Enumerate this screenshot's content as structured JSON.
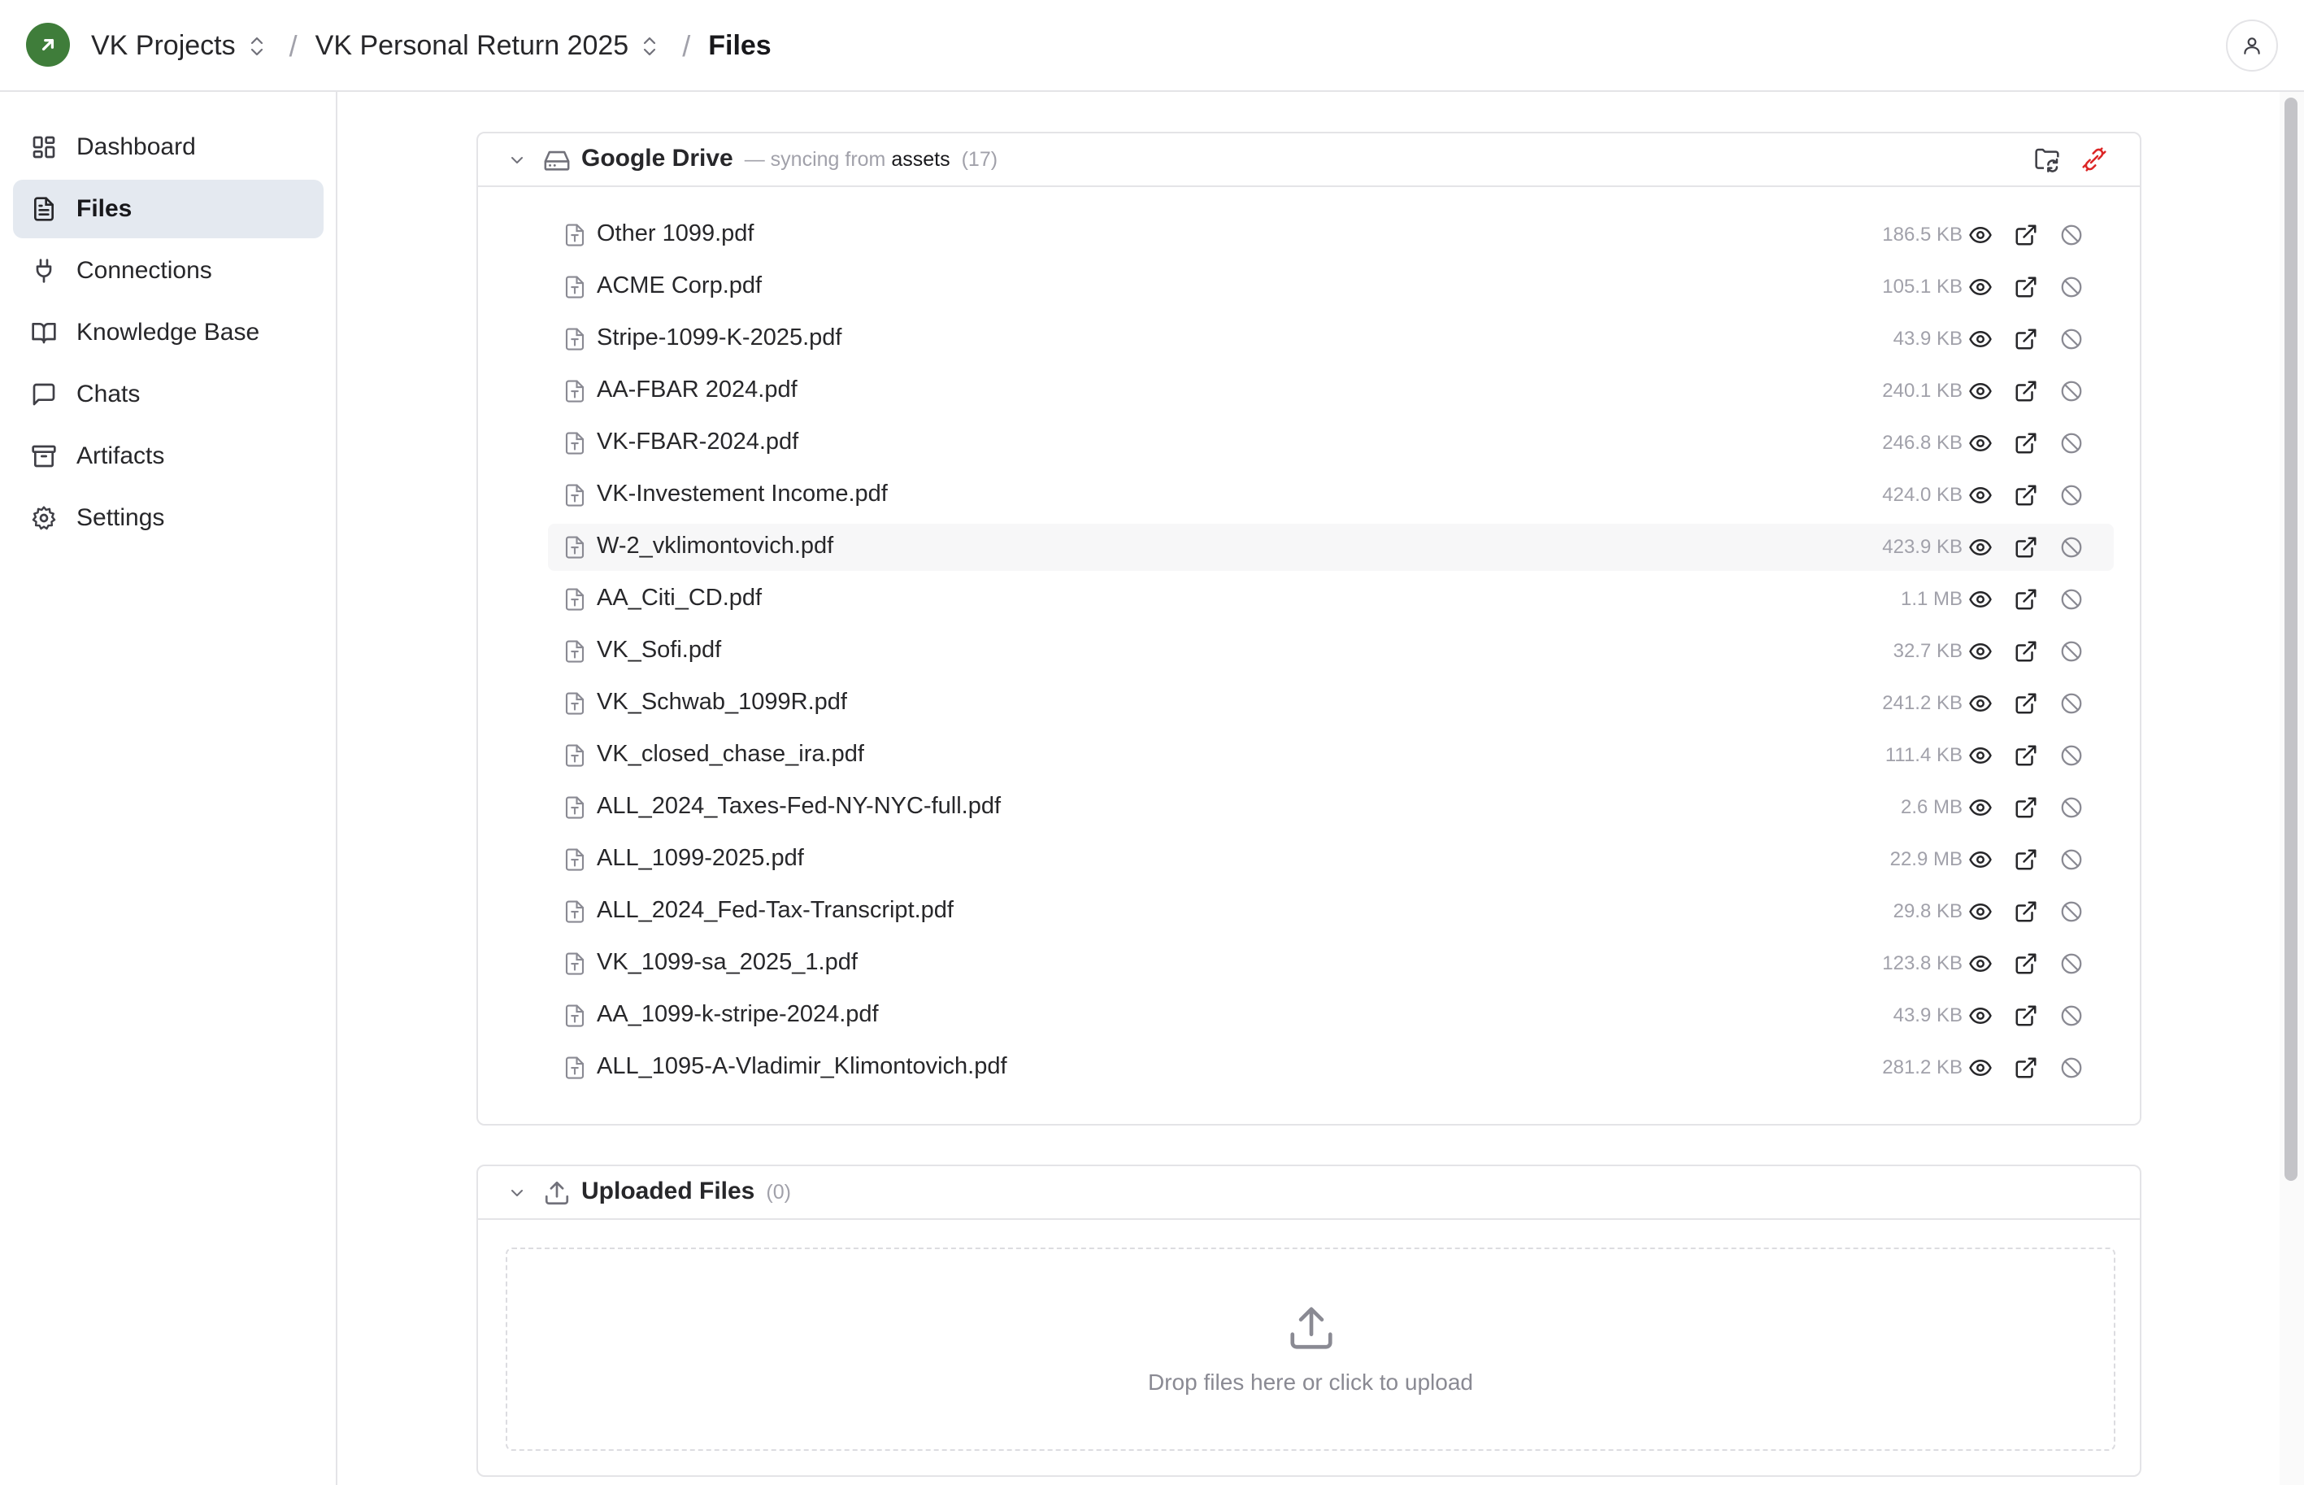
{
  "topbar": {
    "breadcrumbs": [
      {
        "label": "VK Projects"
      },
      {
        "label": "VK Personal Return 2025"
      },
      {
        "label": "Files"
      }
    ],
    "separator": "/",
    "brand_color": "#3f7d3a"
  },
  "sidebar": {
    "items": [
      {
        "label": "Dashboard",
        "icon": "dashboard-icon",
        "active": false
      },
      {
        "label": "Files",
        "icon": "file-text-icon",
        "active": true
      },
      {
        "label": "Connections",
        "icon": "plug-icon",
        "active": false
      },
      {
        "label": "Knowledge Base",
        "icon": "book-icon",
        "active": false
      },
      {
        "label": "Chats",
        "icon": "chat-icon",
        "active": false
      },
      {
        "label": "Artifacts",
        "icon": "archive-icon",
        "active": false
      },
      {
        "label": "Settings",
        "icon": "gear-icon",
        "active": false
      }
    ]
  },
  "drive_panel": {
    "title": "Google Drive",
    "sync_prefix": "— syncing from",
    "sync_folder": "assets",
    "count": "(17)",
    "files": [
      {
        "name": "Other 1099.pdf",
        "size": "186.5 KB"
      },
      {
        "name": "ACME Corp.pdf",
        "size": "105.1 KB"
      },
      {
        "name": "Stripe-1099-K-2025.pdf",
        "size": "43.9 KB"
      },
      {
        "name": "AA-FBAR 2024.pdf",
        "size": "240.1 KB"
      },
      {
        "name": "VK-FBAR-2024.pdf",
        "size": "246.8 KB"
      },
      {
        "name": "VK-Investement Income.pdf",
        "size": "424.0 KB"
      },
      {
        "name": "W-2_vklimontovich.pdf",
        "size": "423.9 KB"
      },
      {
        "name": "AA_Citi_CD.pdf",
        "size": "1.1 MB"
      },
      {
        "name": "VK_Sofi.pdf",
        "size": "32.7 KB"
      },
      {
        "name": "VK_Schwab_1099R.pdf",
        "size": "241.2 KB"
      },
      {
        "name": "VK_closed_chase_ira.pdf",
        "size": "111.4 KB"
      },
      {
        "name": "ALL_2024_Taxes-Fed-NY-NYC-full.pdf",
        "size": "2.6 MB"
      },
      {
        "name": "ALL_1099-2025.pdf",
        "size": "22.9 MB"
      },
      {
        "name": "ALL_2024_Fed-Tax-Transcript.pdf",
        "size": "29.8 KB"
      },
      {
        "name": "VK_1099-sa_2025_1.pdf",
        "size": "123.8 KB"
      },
      {
        "name": "AA_1099-k-stripe-2024.pdf",
        "size": "43.9 KB"
      },
      {
        "name": "ALL_1095-A-Vladimir_Klimontovich.pdf",
        "size": "281.2 KB"
      }
    ]
  },
  "uploads_panel": {
    "title": "Uploaded Files",
    "count": "(0)",
    "drop_hint": "Drop files here or click to upload"
  },
  "colors": {
    "unlink": "#dc2626",
    "active_nav_bg": "#e4e9f0",
    "muted_text": "#a1a1aa"
  }
}
